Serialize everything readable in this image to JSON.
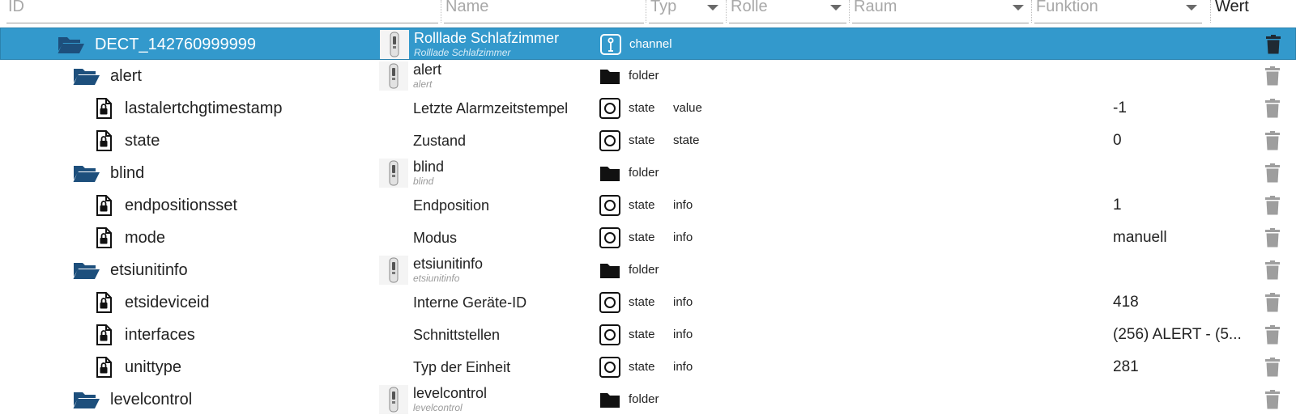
{
  "filters": {
    "id_placeholder": "ID",
    "name_placeholder": "Name",
    "type_label": "Typ",
    "role_label": "Rolle",
    "room_label": "Raum",
    "function_label": "Funktion",
    "value_header": "Wert"
  },
  "colors": {
    "selected_row": "#3399cc",
    "folder_icon": "#1d4f7c",
    "trash_icon": "#9e9e9e"
  },
  "rows": [
    {
      "id": "DECT_142760999999",
      "name": "Rolllade Schlafzimmer",
      "name_sub": "Rolllade Schlafzimmer",
      "type": "channel",
      "role": "",
      "value": "",
      "icon": "folder-open-icon",
      "selected": true
    },
    {
      "id": "alert",
      "name": "alert",
      "name_sub": "alert",
      "type": "folder",
      "role": "",
      "value": "",
      "icon": "folder-open-icon"
    },
    {
      "id": "lastalertchgtimestamp",
      "name": "Letzte Alarmzeitstempel",
      "name_sub": "",
      "type": "state",
      "role": "value",
      "value": "-1",
      "icon": "locked-file-icon"
    },
    {
      "id": "state",
      "name": "Zustand",
      "name_sub": "",
      "type": "state",
      "role": "state",
      "value": "0",
      "icon": "locked-file-icon"
    },
    {
      "id": "blind",
      "name": "blind",
      "name_sub": "blind",
      "type": "folder",
      "role": "",
      "value": "",
      "icon": "folder-open-icon"
    },
    {
      "id": "endpositionsset",
      "name": "Endposition",
      "name_sub": "",
      "type": "state",
      "role": "info",
      "value": "1",
      "icon": "locked-file-icon"
    },
    {
      "id": "mode",
      "name": "Modus",
      "name_sub": "",
      "type": "state",
      "role": "info",
      "value": "manuell",
      "icon": "locked-file-icon"
    },
    {
      "id": "etsiunitinfo",
      "name": "etsiunitinfo",
      "name_sub": "etsiunitinfo",
      "type": "folder",
      "role": "",
      "value": "",
      "icon": "folder-open-icon"
    },
    {
      "id": "etsideviceid",
      "name": "Interne Geräte-ID",
      "name_sub": "",
      "type": "state",
      "role": "info",
      "value": "418",
      "icon": "locked-file-icon"
    },
    {
      "id": "interfaces",
      "name": "Schnittstellen",
      "name_sub": "",
      "type": "state",
      "role": "info",
      "value": "(256) ALERT - (5...",
      "icon": "locked-file-icon"
    },
    {
      "id": "unittype",
      "name": "Typ der Einheit",
      "name_sub": "",
      "type": "state",
      "role": "info",
      "value": "281",
      "icon": "locked-file-icon"
    },
    {
      "id": "levelcontrol",
      "name": "levelcontrol",
      "name_sub": "levelcontrol",
      "type": "folder",
      "role": "",
      "value": "",
      "icon": "folder-open-icon"
    }
  ]
}
